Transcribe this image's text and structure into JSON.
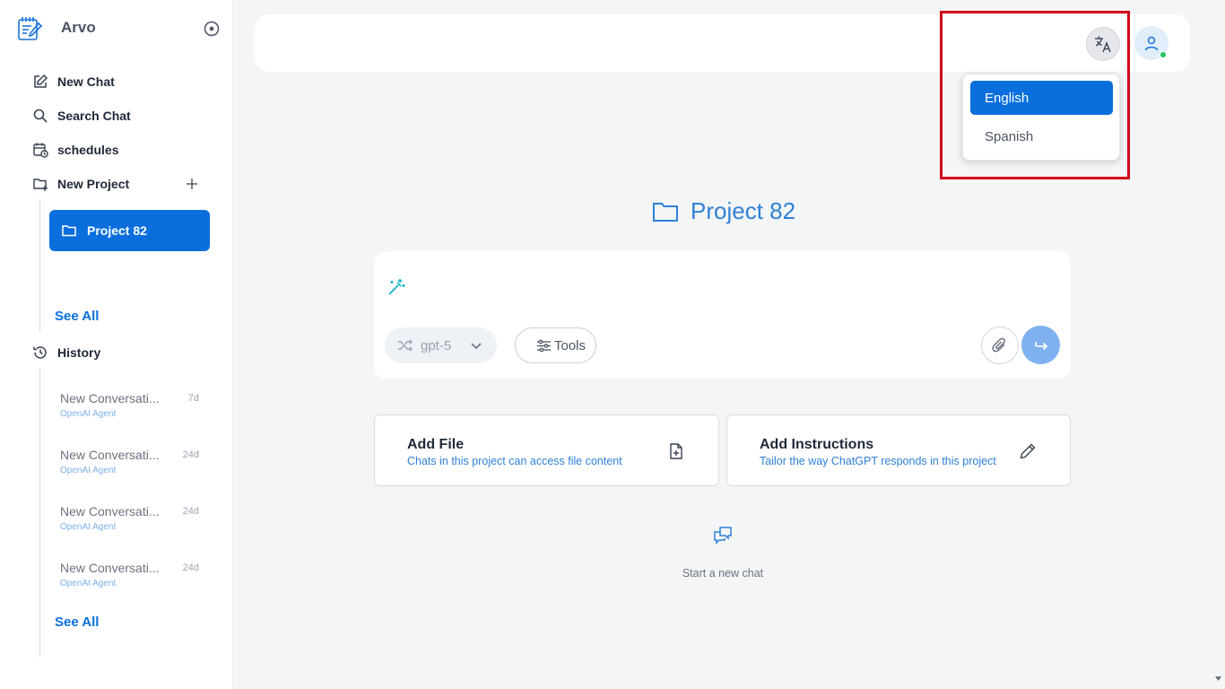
{
  "app": {
    "name": "Arvo"
  },
  "sidebar": {
    "nav": [
      {
        "label": "New Chat",
        "icon": "edit-icon"
      },
      {
        "label": "Search Chat",
        "icon": "search-icon"
      },
      {
        "label": "schedules",
        "icon": "calendar-clock-icon"
      },
      {
        "label": "New Project",
        "icon": "folder-plus-icon"
      }
    ],
    "projects": [
      {
        "label": "Project 82",
        "active": true
      }
    ],
    "projects_see_all": "See All",
    "history_label": "History",
    "history": [
      {
        "title": "New Conversati...",
        "subtitle": "OpenAI Agent",
        "age": "7d"
      },
      {
        "title": "New Conversati...",
        "subtitle": "OpenAI Agent",
        "age": "24d"
      },
      {
        "title": "New Conversati...",
        "subtitle": "OpenAI Agent",
        "age": "24d"
      },
      {
        "title": "New Conversati...",
        "subtitle": "OpenAI Agent",
        "age": "24d"
      }
    ],
    "history_see_all": "See All"
  },
  "language_menu": {
    "options": [
      {
        "label": "English",
        "selected": true
      },
      {
        "label": "Spanish",
        "selected": false
      }
    ]
  },
  "main": {
    "project_title": "Project 82",
    "composer": {
      "model": "gpt-5",
      "tools_label": "Tools"
    },
    "cards": [
      {
        "title": "Add File",
        "subtitle": "Chats in this project can access file content",
        "icon": "file-plus-icon"
      },
      {
        "title": "Add Instructions",
        "subtitle": "Tailor the way ChatGPT responds in this project",
        "icon": "pencil-icon"
      }
    ],
    "empty_state": "Start a new chat"
  },
  "colors": {
    "accent": "#0a6fdc",
    "title_blue": "#2f80d6",
    "send_button": "#7fb0ef",
    "highlight_border": "#d0021b",
    "online": "#22c55e"
  }
}
